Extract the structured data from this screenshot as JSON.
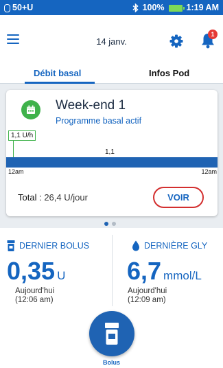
{
  "status_bar": {
    "carrier": "50+U",
    "battery": "100%",
    "time": "1:19 AM",
    "battery_color": "#7ed957"
  },
  "header": {
    "date": "14 janv.",
    "notification_count": "1",
    "icons": [
      "menu-icon",
      "gear-icon",
      "bell-icon"
    ]
  },
  "tabs": [
    {
      "label": "Débit basal",
      "active": true
    },
    {
      "label": "Infos Pod",
      "active": false
    }
  ],
  "basal_card": {
    "program_name": "Week-end 1",
    "status": "Programme basal actif",
    "current_rate": "1,1 U/h",
    "segment_label": "1,1",
    "axis_start": "12am",
    "axis_end": "12am",
    "total_label": "Total :",
    "total_value": "26,4 U/jour",
    "view_button": "VOIR",
    "icon": "calendar-icon"
  },
  "pager": {
    "count": 2,
    "active": 0
  },
  "last_bolus": {
    "title": "DERNIER BOLUS",
    "value": "0,35",
    "unit": "U",
    "day": "Aujourd'hui",
    "time": "(12:06 am)"
  },
  "last_glucose": {
    "title": "DERNIÈRE GLY",
    "value": "6,7",
    "unit": "mmol/L",
    "day": "Aujourd'hui",
    "time": "(12:09 am)"
  },
  "bolus_button": {
    "label": "Bolus"
  },
  "colors": {
    "primary": "#1565c0",
    "bar": "#1f63b3",
    "active_green": "#3fb24b",
    "alert_red": "#d32f2f"
  }
}
